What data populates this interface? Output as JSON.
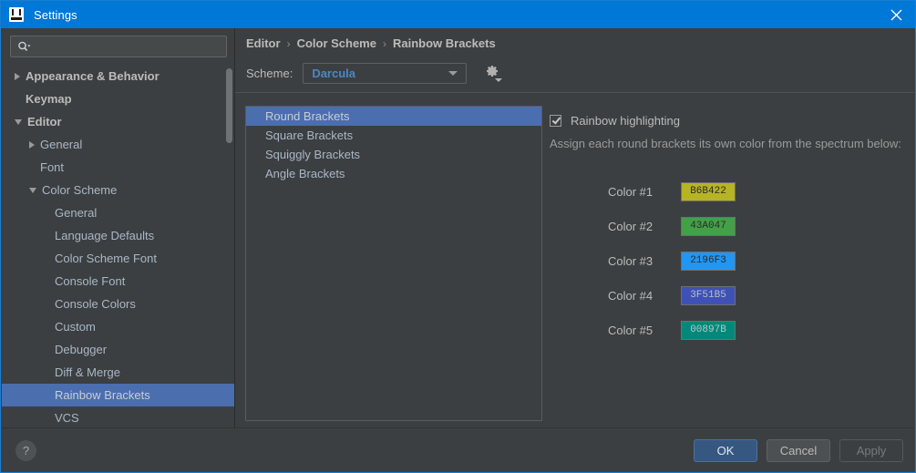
{
  "window": {
    "title": "Settings",
    "app_icon": "intellij-idea-icon",
    "close_icon": "close-icon",
    "accent_color": "#0078d7"
  },
  "search": {
    "value": "",
    "placeholder": "",
    "icon": "search-icon"
  },
  "sidebar": {
    "items": [
      {
        "label": "Appearance & Behavior",
        "indent": 0,
        "arrow": "right",
        "bold": true,
        "selected": false
      },
      {
        "label": "Keymap",
        "indent": 0,
        "arrow": "none",
        "bold": true,
        "selected": false
      },
      {
        "label": "Editor",
        "indent": 0,
        "arrow": "down",
        "bold": true,
        "selected": false
      },
      {
        "label": "General",
        "indent": 1,
        "arrow": "right",
        "bold": false,
        "selected": false
      },
      {
        "label": "Font",
        "indent": 1,
        "arrow": "none",
        "bold": false,
        "selected": false
      },
      {
        "label": "Color Scheme",
        "indent": 1,
        "arrow": "down",
        "bold": false,
        "selected": false
      },
      {
        "label": "General",
        "indent": 2,
        "arrow": "none",
        "bold": false,
        "selected": false
      },
      {
        "label": "Language Defaults",
        "indent": 2,
        "arrow": "none",
        "bold": false,
        "selected": false
      },
      {
        "label": "Color Scheme Font",
        "indent": 2,
        "arrow": "none",
        "bold": false,
        "selected": false
      },
      {
        "label": "Console Font",
        "indent": 2,
        "arrow": "none",
        "bold": false,
        "selected": false
      },
      {
        "label": "Console Colors",
        "indent": 2,
        "arrow": "none",
        "bold": false,
        "selected": false
      },
      {
        "label": "Custom",
        "indent": 2,
        "arrow": "none",
        "bold": false,
        "selected": false
      },
      {
        "label": "Debugger",
        "indent": 2,
        "arrow": "none",
        "bold": false,
        "selected": false
      },
      {
        "label": "Diff & Merge",
        "indent": 2,
        "arrow": "none",
        "bold": false,
        "selected": false
      },
      {
        "label": "Rainbow Brackets",
        "indent": 2,
        "arrow": "none",
        "bold": false,
        "selected": true
      },
      {
        "label": "VCS",
        "indent": 2,
        "arrow": "none",
        "bold": false,
        "selected": false
      }
    ]
  },
  "breadcrumb": {
    "items": [
      "Editor",
      "Color Scheme",
      "Rainbow Brackets"
    ],
    "separator": "›"
  },
  "scheme": {
    "label": "Scheme:",
    "value": "Darcula",
    "gear_icon": "gear-icon",
    "dropdown_icon": "chevron-down-icon"
  },
  "bracket_list": {
    "items": [
      {
        "label": "Round Brackets",
        "selected": true
      },
      {
        "label": "Square Brackets",
        "selected": false
      },
      {
        "label": "Squiggly Brackets",
        "selected": false
      },
      {
        "label": "Angle Brackets",
        "selected": false
      }
    ]
  },
  "options": {
    "rainbow_highlighting": {
      "label": "Rainbow highlighting",
      "checked": true
    },
    "hint": "Assign each round brackets its own color from the spectrum below:",
    "colors": [
      {
        "label": "Color #1",
        "value": "B6B422",
        "hex": "#B6B422",
        "text_color": "#2b2b2b"
      },
      {
        "label": "Color #2",
        "value": "43A047",
        "hex": "#43A047",
        "text_color": "#2b2b2b"
      },
      {
        "label": "Color #3",
        "value": "2196F3",
        "hex": "#2196F3",
        "text_color": "#2b2b2b"
      },
      {
        "label": "Color #4",
        "value": "3F51B5",
        "hex": "#3F51B5",
        "text_color": "#b8bec8"
      },
      {
        "label": "Color #5",
        "value": "00897B",
        "hex": "#00897B",
        "text_color": "#b8c6c4"
      }
    ]
  },
  "footer": {
    "help_label": "?",
    "ok_label": "OK",
    "cancel_label": "Cancel",
    "apply_label": "Apply",
    "apply_disabled": true
  }
}
